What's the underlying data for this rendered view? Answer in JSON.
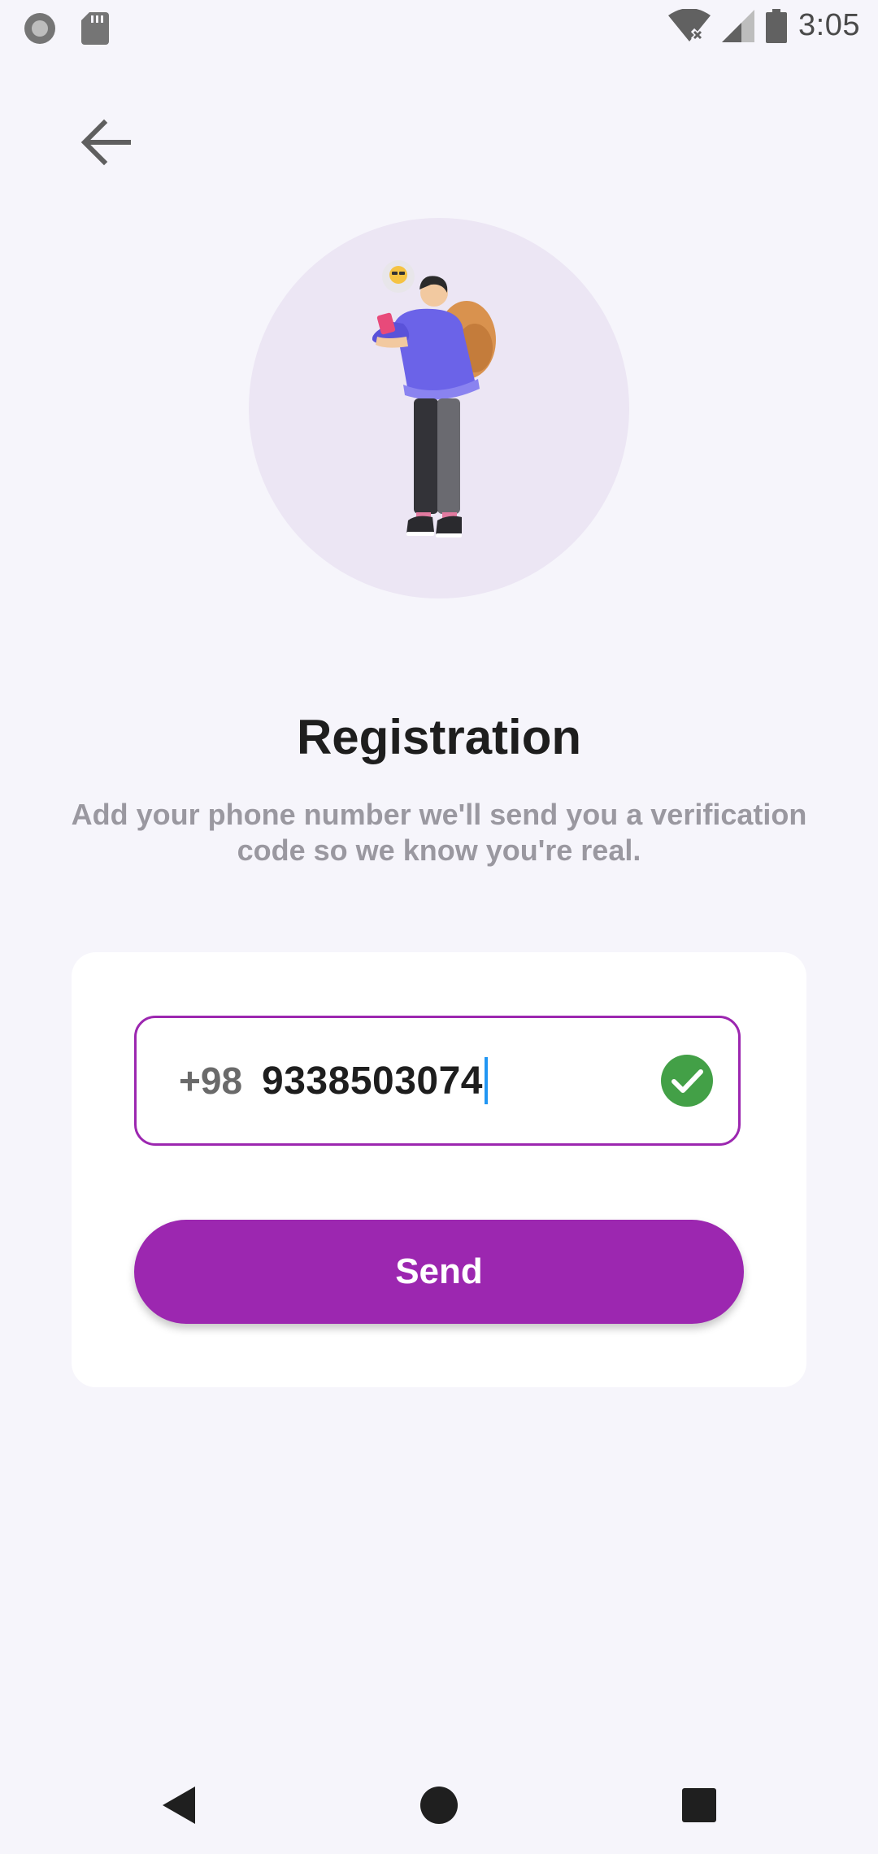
{
  "status_bar": {
    "time": "3:05",
    "icons": [
      "record-icon",
      "sd-card-icon",
      "wifi-no-internet-icon",
      "cell-signal-icon",
      "battery-icon"
    ]
  },
  "header": {
    "back_icon": "arrow-left-icon"
  },
  "illustration": {
    "description_icon": "person-with-phone-illustration",
    "circle_color": "#ece6f4"
  },
  "main": {
    "title": "Registration",
    "subtitle": "Add your phone number we'll send you a verification code so we know you're real."
  },
  "form": {
    "country_code": "+98",
    "phone_number": "9338503074",
    "valid_icon": "check-circle-icon",
    "send_label": "Send"
  },
  "nav_bar": {
    "icons": [
      "back-triangle-icon",
      "home-circle-icon",
      "recents-square-icon"
    ]
  },
  "colors": {
    "accent": "#9c27b0",
    "success": "#43a047",
    "background": "#f6f5fb",
    "card": "#ffffff"
  }
}
